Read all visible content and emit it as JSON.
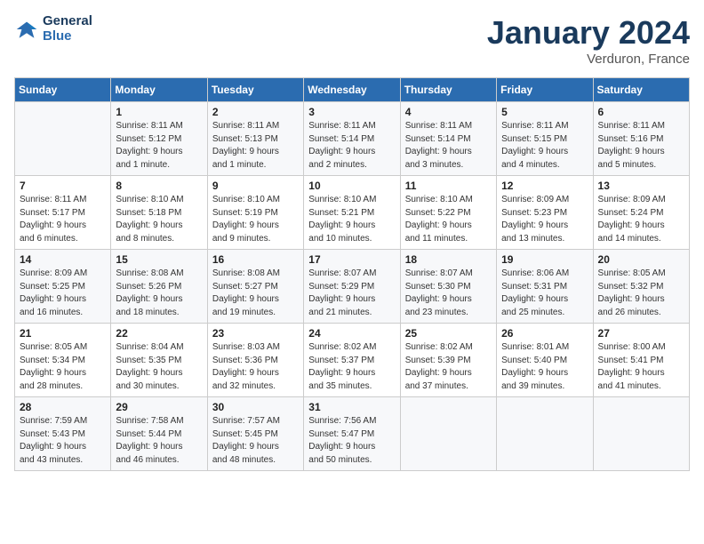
{
  "header": {
    "logo_line1": "General",
    "logo_line2": "Blue",
    "month_title": "January 2024",
    "location": "Verduron, France"
  },
  "days_of_week": [
    "Sunday",
    "Monday",
    "Tuesday",
    "Wednesday",
    "Thursday",
    "Friday",
    "Saturday"
  ],
  "weeks": [
    [
      {
        "day": "",
        "info": ""
      },
      {
        "day": "1",
        "info": "Sunrise: 8:11 AM\nSunset: 5:12 PM\nDaylight: 9 hours\nand 1 minute."
      },
      {
        "day": "2",
        "info": "Sunrise: 8:11 AM\nSunset: 5:13 PM\nDaylight: 9 hours\nand 1 minute."
      },
      {
        "day": "3",
        "info": "Sunrise: 8:11 AM\nSunset: 5:14 PM\nDaylight: 9 hours\nand 2 minutes."
      },
      {
        "day": "4",
        "info": "Sunrise: 8:11 AM\nSunset: 5:14 PM\nDaylight: 9 hours\nand 3 minutes."
      },
      {
        "day": "5",
        "info": "Sunrise: 8:11 AM\nSunset: 5:15 PM\nDaylight: 9 hours\nand 4 minutes."
      },
      {
        "day": "6",
        "info": "Sunrise: 8:11 AM\nSunset: 5:16 PM\nDaylight: 9 hours\nand 5 minutes."
      }
    ],
    [
      {
        "day": "7",
        "info": "Sunrise: 8:11 AM\nSunset: 5:17 PM\nDaylight: 9 hours\nand 6 minutes."
      },
      {
        "day": "8",
        "info": "Sunrise: 8:10 AM\nSunset: 5:18 PM\nDaylight: 9 hours\nand 8 minutes."
      },
      {
        "day": "9",
        "info": "Sunrise: 8:10 AM\nSunset: 5:19 PM\nDaylight: 9 hours\nand 9 minutes."
      },
      {
        "day": "10",
        "info": "Sunrise: 8:10 AM\nSunset: 5:21 PM\nDaylight: 9 hours\nand 10 minutes."
      },
      {
        "day": "11",
        "info": "Sunrise: 8:10 AM\nSunset: 5:22 PM\nDaylight: 9 hours\nand 11 minutes."
      },
      {
        "day": "12",
        "info": "Sunrise: 8:09 AM\nSunset: 5:23 PM\nDaylight: 9 hours\nand 13 minutes."
      },
      {
        "day": "13",
        "info": "Sunrise: 8:09 AM\nSunset: 5:24 PM\nDaylight: 9 hours\nand 14 minutes."
      }
    ],
    [
      {
        "day": "14",
        "info": "Sunrise: 8:09 AM\nSunset: 5:25 PM\nDaylight: 9 hours\nand 16 minutes."
      },
      {
        "day": "15",
        "info": "Sunrise: 8:08 AM\nSunset: 5:26 PM\nDaylight: 9 hours\nand 18 minutes."
      },
      {
        "day": "16",
        "info": "Sunrise: 8:08 AM\nSunset: 5:27 PM\nDaylight: 9 hours\nand 19 minutes."
      },
      {
        "day": "17",
        "info": "Sunrise: 8:07 AM\nSunset: 5:29 PM\nDaylight: 9 hours\nand 21 minutes."
      },
      {
        "day": "18",
        "info": "Sunrise: 8:07 AM\nSunset: 5:30 PM\nDaylight: 9 hours\nand 23 minutes."
      },
      {
        "day": "19",
        "info": "Sunrise: 8:06 AM\nSunset: 5:31 PM\nDaylight: 9 hours\nand 25 minutes."
      },
      {
        "day": "20",
        "info": "Sunrise: 8:05 AM\nSunset: 5:32 PM\nDaylight: 9 hours\nand 26 minutes."
      }
    ],
    [
      {
        "day": "21",
        "info": "Sunrise: 8:05 AM\nSunset: 5:34 PM\nDaylight: 9 hours\nand 28 minutes."
      },
      {
        "day": "22",
        "info": "Sunrise: 8:04 AM\nSunset: 5:35 PM\nDaylight: 9 hours\nand 30 minutes."
      },
      {
        "day": "23",
        "info": "Sunrise: 8:03 AM\nSunset: 5:36 PM\nDaylight: 9 hours\nand 32 minutes."
      },
      {
        "day": "24",
        "info": "Sunrise: 8:02 AM\nSunset: 5:37 PM\nDaylight: 9 hours\nand 35 minutes."
      },
      {
        "day": "25",
        "info": "Sunrise: 8:02 AM\nSunset: 5:39 PM\nDaylight: 9 hours\nand 37 minutes."
      },
      {
        "day": "26",
        "info": "Sunrise: 8:01 AM\nSunset: 5:40 PM\nDaylight: 9 hours\nand 39 minutes."
      },
      {
        "day": "27",
        "info": "Sunrise: 8:00 AM\nSunset: 5:41 PM\nDaylight: 9 hours\nand 41 minutes."
      }
    ],
    [
      {
        "day": "28",
        "info": "Sunrise: 7:59 AM\nSunset: 5:43 PM\nDaylight: 9 hours\nand 43 minutes."
      },
      {
        "day": "29",
        "info": "Sunrise: 7:58 AM\nSunset: 5:44 PM\nDaylight: 9 hours\nand 46 minutes."
      },
      {
        "day": "30",
        "info": "Sunrise: 7:57 AM\nSunset: 5:45 PM\nDaylight: 9 hours\nand 48 minutes."
      },
      {
        "day": "31",
        "info": "Sunrise: 7:56 AM\nSunset: 5:47 PM\nDaylight: 9 hours\nand 50 minutes."
      },
      {
        "day": "",
        "info": ""
      },
      {
        "day": "",
        "info": ""
      },
      {
        "day": "",
        "info": ""
      }
    ]
  ]
}
